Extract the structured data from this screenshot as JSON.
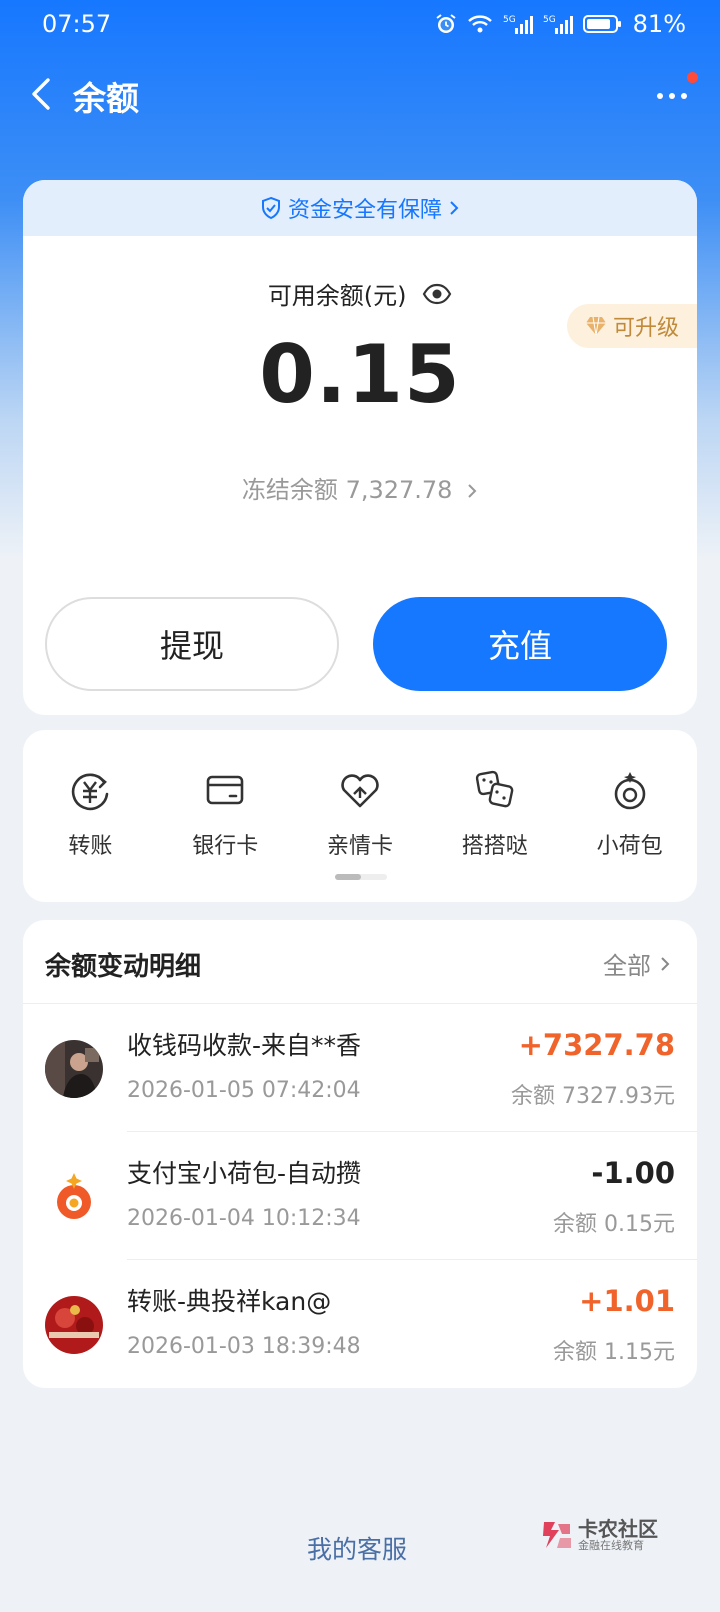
{
  "status_bar": {
    "time": "07:57",
    "battery": "81%",
    "icons": [
      "alarm-icon",
      "wifi-icon",
      "signal-5g-icon",
      "signal-5g-icon",
      "battery-icon"
    ]
  },
  "nav": {
    "title": "余额",
    "back_icon": "chevron-left-icon",
    "more_icon": "more-icon"
  },
  "balance": {
    "safety_text": "资金安全有保障",
    "available_label": "可用余额(元)",
    "upgrade_label": "可升级",
    "amount": "0.15",
    "frozen_label": "冻结余额",
    "frozen_amount": "7,327.78",
    "withdraw_label": "提现",
    "recharge_label": "充值"
  },
  "shortcuts": [
    {
      "label": "转账",
      "icon": "transfer-icon"
    },
    {
      "label": "银行卡",
      "icon": "bank-card-icon"
    },
    {
      "label": "亲情卡",
      "icon": "family-card-icon"
    },
    {
      "label": "搭搭哒",
      "icon": "dice-icon"
    },
    {
      "label": "小荷包",
      "icon": "purse-icon"
    }
  ],
  "details": {
    "title": "余额变动明细",
    "all_label": "全部",
    "transactions": [
      {
        "title": "收钱码收款-来自**香",
        "time": "2026-01-05 07:42:04",
        "amount": "+7327.78",
        "balance": "余额 7327.93元"
      },
      {
        "title": "支付宝小荷包-自动攒",
        "time": "2026-01-04 10:12:34",
        "amount": "-1.00",
        "balance": "余额 0.15元"
      },
      {
        "title": "转账-典投祥kan@",
        "time": "2026-01-03 18:39:48",
        "amount": "+1.01",
        "balance": "余额 1.15元"
      }
    ]
  },
  "footer": {
    "customer_service": "我的客服",
    "watermark_main": "卡农社区",
    "watermark_sub": "金融在线教育"
  },
  "colors": {
    "primary": "#1677ff",
    "positive": "#f0632a",
    "upgrade": "#c08a3a"
  }
}
